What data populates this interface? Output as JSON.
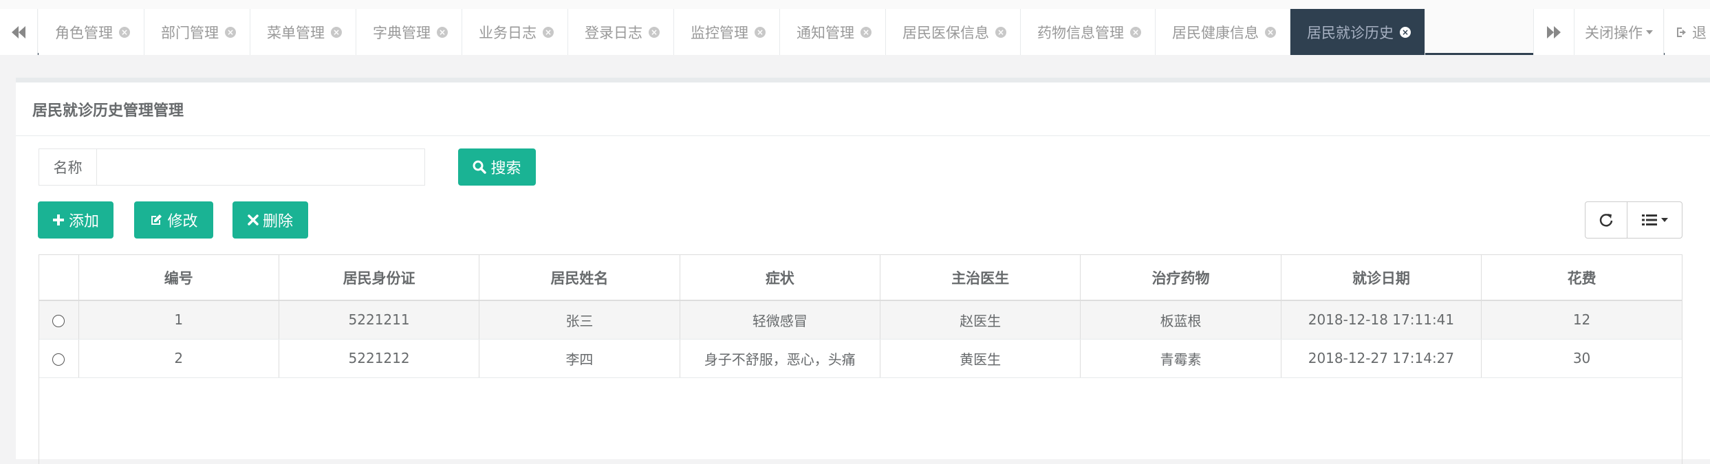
{
  "tabs": [
    {
      "label": "角色管理",
      "active": false
    },
    {
      "label": "部门管理",
      "active": false
    },
    {
      "label": "菜单管理",
      "active": false
    },
    {
      "label": "字典管理",
      "active": false
    },
    {
      "label": "业务日志",
      "active": false
    },
    {
      "label": "登录日志",
      "active": false
    },
    {
      "label": "监控管理",
      "active": false
    },
    {
      "label": "通知管理",
      "active": false
    },
    {
      "label": "居民医保信息",
      "active": false
    },
    {
      "label": "药物信息管理",
      "active": false
    },
    {
      "label": "居民健康信息",
      "active": false
    },
    {
      "label": "居民就诊历史",
      "active": true
    }
  ],
  "tabbar": {
    "close_ops_label": "关闭操作",
    "exit_label": "退"
  },
  "panel": {
    "title": "居民就诊历史管理管理"
  },
  "search": {
    "addon_label": "名称",
    "input_value": "",
    "button_label": "搜索"
  },
  "toolbar": {
    "add_label": "添加",
    "edit_label": "修改",
    "delete_label": "删除"
  },
  "table": {
    "columns": [
      "编号",
      "居民身份证",
      "居民姓名",
      "症状",
      "主治医生",
      "治疗药物",
      "就诊日期",
      "花费"
    ],
    "rows": [
      [
        "1",
        "5221211",
        "张三",
        "轻微感冒",
        "赵医生",
        "板蓝根",
        "2018-12-18 17:11:41",
        "12"
      ],
      [
        "2",
        "5221212",
        "李四",
        "身子不舒服，恶心，头痛",
        "黄医生",
        "青霉素",
        "2018-12-27 17:14:27",
        "30"
      ]
    ]
  },
  "colors": {
    "primary": "#1ab394",
    "active_tab": "#2f4050"
  }
}
